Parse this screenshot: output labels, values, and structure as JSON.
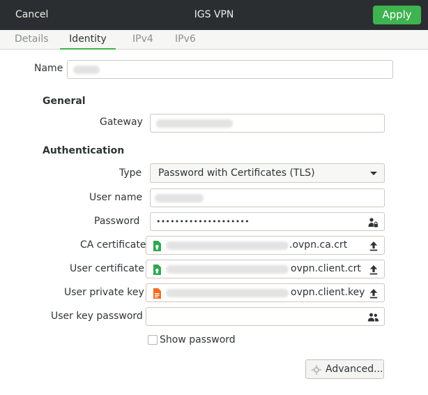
{
  "header": {
    "cancel_label": "Cancel",
    "title": "IGS VPN",
    "apply_label": "Apply"
  },
  "tabs": [
    {
      "label": "Details",
      "active": false
    },
    {
      "label": "Identity",
      "active": true
    },
    {
      "label": "IPv4",
      "active": false
    },
    {
      "label": "IPv6",
      "active": false
    }
  ],
  "form": {
    "name_label": "Name",
    "general_heading": "General",
    "gateway_label": "Gateway",
    "authentication_heading": "Authentication",
    "type_label": "Type",
    "type_value": "Password with Certificates (TLS)",
    "username_label": "User name",
    "password_label": "Password",
    "password_value": "••••••••••••••••••••",
    "ca_cert_label": "CA certificate",
    "ca_cert_suffix": ".ovpn.ca.crt",
    "user_cert_label": "User certificate",
    "user_cert_suffix": "ovpn.client.crt",
    "user_key_label": "User private key",
    "user_key_suffix": "ovpn.client.key",
    "user_key_password_label": "User key password",
    "show_password_label": "Show password",
    "show_password_checked": false,
    "advanced_label": "Advanced..."
  },
  "colors": {
    "headerbar_bg": "#2b2e30",
    "accent_green": "#3eb34f",
    "cert_icon_green": "#2fa84f",
    "key_icon_orange": "#f26b21"
  },
  "icons": {
    "password_storage": "user-lock-icon",
    "upload": "upload-arrow-icon",
    "user_key_storage": "users-icon",
    "advanced": "gear-icon",
    "cert_file": "certificate-file-icon",
    "key_file": "key-file-icon"
  }
}
